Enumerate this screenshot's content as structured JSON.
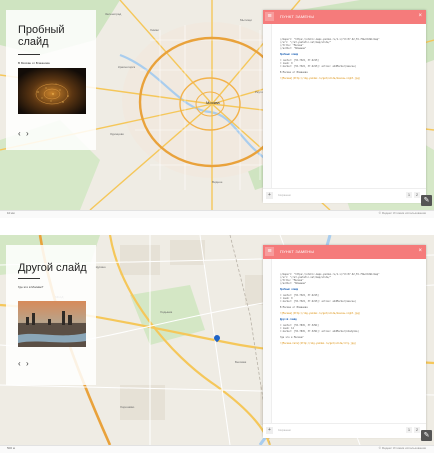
{
  "panels": [
    {
      "slide": {
        "title": "Пробный слайд",
        "subtitle": "В Москве от Влажнова",
        "prev_icon": "‹",
        "next_icon": "›"
      },
      "map": {
        "city_label": "Москва",
        "place_labels": [
          "Химки",
          "Мытищи",
          "Королёв",
          "Балашиха",
          "Люберцы",
          "Одинцово",
          "Красногорск",
          "Реутов",
          "Видное",
          "Зеленоград"
        ],
        "scale_text": "10 км",
        "copyright_text": "© Яндекс Условия использования"
      },
      "editor": {
        "header_btn": "≡",
        "title": "ПУНКТ ЗАМЕНЫ",
        "close_icon": "×",
        "lines": [
          {
            "kind": "code",
            "text": "//mapurl: \"https://static-maps.yandex.ru/1.x/?ll=37.62,55.75&z=10&l=map\""
          },
          {
            "kind": "code",
            "text": "//url: \"//s3.yastatic.net/map/slide/\""
          },
          {
            "kind": "code",
            "text": "//title: \"Москва\""
          },
          {
            "kind": "code",
            "text": "//author: \"Влажнов\""
          },
          {
            "kind": "blank",
            "text": ""
          },
          {
            "kind": "heading",
            "text": "Пробный слайд"
          },
          {
            "kind": "blank",
            "text": ""
          },
          {
            "kind": "code",
            "text": "= center: [55.7522, 37.6215]"
          },
          {
            "kind": "code",
            "text": "= zoom: 9"
          },
          {
            "kind": "code",
            "text": "= marker: [55.7522, 37.6215]: action: addMarker(moscow)"
          },
          {
            "kind": "blank",
            "text": ""
          },
          {
            "kind": "code",
            "text": "В Москве от Влажнова"
          },
          {
            "kind": "blank",
            "text": ""
          },
          {
            "kind": "link",
            "text": "![Москва](http://img.yandex.ru/get/slide/moscow-night.jpg)"
          }
        ],
        "status": "Сохранено",
        "pager": [
          "1",
          "2"
        ]
      }
    },
    {
      "slide": {
        "title": "Другой слайд",
        "subtitle": "Где это в Москве?",
        "prev_icon": "‹",
        "next_icon": "›"
      },
      "map": {
        "city_label": "",
        "place_labels": [
          "МКАД",
          "Ходынка",
          "Беговая",
          "Щукино",
          "Хорошёво",
          "Сокол",
          "Полежаевская",
          "Москва-Сити"
        ],
        "scale_text": "500 м",
        "copyright_text": "© Яндекс Условия использования"
      },
      "editor": {
        "header_btn": "≡",
        "title": "ПУНКТ ЗАМЕНЫ",
        "close_icon": "×",
        "lines": [
          {
            "kind": "code",
            "text": "//mapurl: \"https://static-maps.yandex.ru/1.x/?ll=37.62,55.75&z=10&l=map\""
          },
          {
            "kind": "code",
            "text": "//url: \"//s3.yastatic.net/map/slide/\""
          },
          {
            "kind": "code",
            "text": "//title: \"Москва\""
          },
          {
            "kind": "code",
            "text": "//author: \"Влажнов\""
          },
          {
            "kind": "blank",
            "text": ""
          },
          {
            "kind": "heading",
            "text": "Пробный слайд"
          },
          {
            "kind": "blank",
            "text": ""
          },
          {
            "kind": "code",
            "text": "= center: [55.7522, 37.6215]"
          },
          {
            "kind": "code",
            "text": "= zoom: 9"
          },
          {
            "kind": "code",
            "text": "= marker: [55.7522, 37.6215]: action: addMarker(moscow)"
          },
          {
            "kind": "blank",
            "text": ""
          },
          {
            "kind": "code",
            "text": "В Москве от Влажнова"
          },
          {
            "kind": "blank",
            "text": ""
          },
          {
            "kind": "link",
            "text": "![Москва](http://img.yandex.ru/get/slide/moscow-night.jpg)"
          },
          {
            "kind": "blank",
            "text": ""
          },
          {
            "kind": "heading",
            "text": "Другой слайд"
          },
          {
            "kind": "blank",
            "text": ""
          },
          {
            "kind": "code",
            "text": "= center: [55.7845, 37.5291]"
          },
          {
            "kind": "code",
            "text": "= zoom: 14"
          },
          {
            "kind": "code",
            "text": "= marker: [55.7845, 37.5291]: action: addMarker(khodynka)"
          },
          {
            "kind": "blank",
            "text": ""
          },
          {
            "kind": "code",
            "text": "Где это в Москве?"
          },
          {
            "kind": "blank",
            "text": ""
          },
          {
            "kind": "link",
            "text": "![Москва-Сити](http://img.yandex.ru/get/slide/city.jpg)"
          }
        ],
        "status": "Сохранено",
        "pager": [
          "1",
          "2"
        ]
      }
    }
  ],
  "colors": {
    "header_accent": "#f57b7b",
    "ring_road": "#e9a23b",
    "highway": "#f5c75a",
    "pin": "#1e63c6"
  },
  "icons": {
    "pen": "✎"
  }
}
